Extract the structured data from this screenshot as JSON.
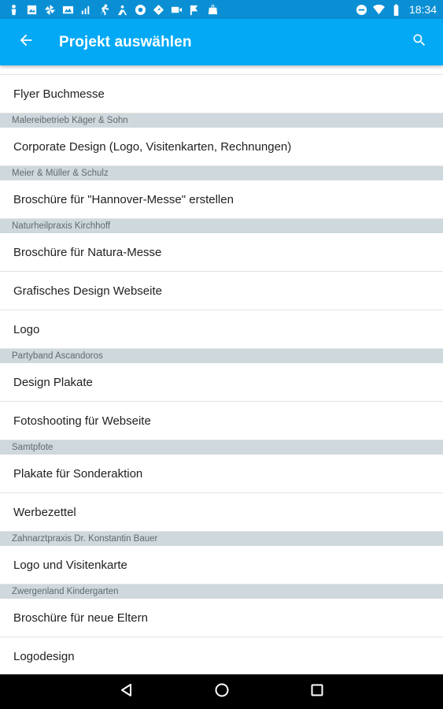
{
  "status_bar": {
    "time": "18:34",
    "left_icons": [
      "person-icon",
      "image-icon",
      "pinwheel-icon",
      "gallery-icon",
      "signal-icon",
      "running-icon",
      "activity-icon",
      "record-icon",
      "navigation-icon",
      "video-icon",
      "flag-icon",
      "bag-icon"
    ],
    "right_icons": [
      "do-not-disturb-icon",
      "wifi-icon",
      "battery-icon"
    ]
  },
  "app_bar": {
    "title": "Projekt auswählen",
    "back_icon": "arrow-back-icon",
    "search_icon": "search-icon"
  },
  "list": {
    "rows": [
      {
        "kind": "item",
        "label": "Flyer Buchmesse"
      },
      {
        "kind": "header",
        "label": "Malereibetrieb Käger & Sohn"
      },
      {
        "kind": "item",
        "label": "Corporate Design (Logo, Visitenkarten, Rechnungen)"
      },
      {
        "kind": "header",
        "label": "Meier & Müller & Schulz"
      },
      {
        "kind": "item",
        "label": "Broschüre für \"Hannover-Messe\" erstellen"
      },
      {
        "kind": "header",
        "label": "Naturheilpraxis Kirchhoff"
      },
      {
        "kind": "item",
        "label": "Broschüre für Natura-Messe"
      },
      {
        "kind": "item",
        "label": "Grafisches Design Webseite"
      },
      {
        "kind": "item",
        "label": "Logo"
      },
      {
        "kind": "header",
        "label": "Partyband Ascandoros"
      },
      {
        "kind": "item",
        "label": "Design Plakate"
      },
      {
        "kind": "item",
        "label": "Fotoshooting für Webseite"
      },
      {
        "kind": "header",
        "label": "Samtpfote"
      },
      {
        "kind": "item",
        "label": "Plakate für Sonderaktion"
      },
      {
        "kind": "item",
        "label": "Werbezettel"
      },
      {
        "kind": "header",
        "label": "Zahnarztpraxis Dr. Konstantin Bauer"
      },
      {
        "kind": "item",
        "label": "Logo und Visitenkarte"
      },
      {
        "kind": "header",
        "label": "Zwergenland Kindergarten"
      },
      {
        "kind": "item",
        "label": "Broschüre für neue Eltern"
      },
      {
        "kind": "item",
        "label": "Logodesign"
      }
    ]
  },
  "nav_bar": {
    "icons": [
      "back-triangle-icon",
      "home-circle-icon",
      "recents-square-icon"
    ]
  },
  "colors": {
    "status_bar": "#0a8fd4",
    "app_bar": "#03a9f4",
    "section_header": "#cfd8dc",
    "nav_bar": "#000000"
  }
}
